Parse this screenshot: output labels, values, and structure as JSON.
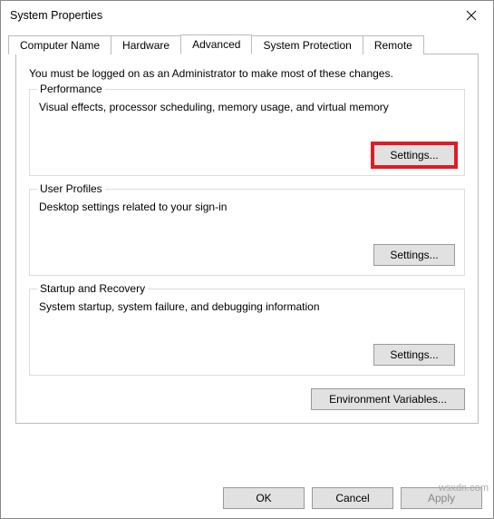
{
  "window": {
    "title": "System Properties"
  },
  "tabs": {
    "items": [
      {
        "label": "Computer Name"
      },
      {
        "label": "Hardware"
      },
      {
        "label": "Advanced"
      },
      {
        "label": "System Protection"
      },
      {
        "label": "Remote"
      }
    ],
    "active_index": 2
  },
  "panel": {
    "admin_note": "You must be logged on as an Administrator to make most of these changes.",
    "performance": {
      "legend": "Performance",
      "desc": "Visual effects, processor scheduling, memory usage, and virtual memory",
      "button": "Settings..."
    },
    "user_profiles": {
      "legend": "User Profiles",
      "desc": "Desktop settings related to your sign-in",
      "button": "Settings..."
    },
    "startup_recovery": {
      "legend": "Startup and Recovery",
      "desc": "System startup, system failure, and debugging information",
      "button": "Settings..."
    },
    "env_button": "Environment Variables..."
  },
  "dialog_buttons": {
    "ok": "OK",
    "cancel": "Cancel",
    "apply": "Apply"
  },
  "watermark": "wsxdn.com"
}
